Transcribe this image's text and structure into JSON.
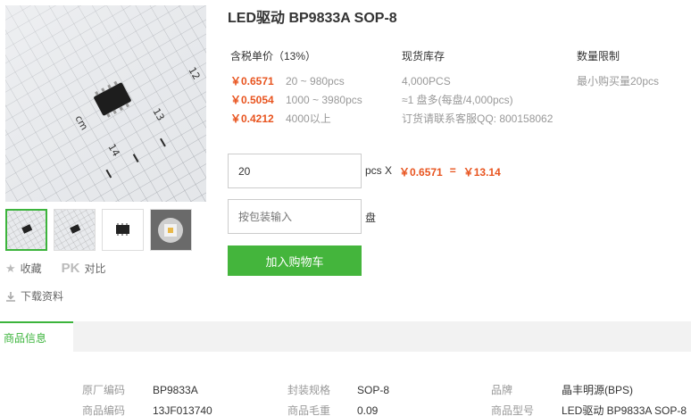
{
  "product": {
    "title": "LED驱动 BP9833A SOP-8"
  },
  "pricing": {
    "header": "含税单价（13%）",
    "tiers": [
      {
        "price": "￥0.6571",
        "range": "20 ~ 980pcs"
      },
      {
        "price": "￥0.5054",
        "range": "1000 ~ 3980pcs"
      },
      {
        "price": "￥0.4212",
        "range": "4000以上"
      }
    ]
  },
  "stock": {
    "header": "现货库存",
    "lines": [
      "4,000PCS",
      "≈1 盘多(每盘/4,000pcs)",
      "订货请联系客服QQ: 800158062"
    ]
  },
  "limit": {
    "header": "数量限制",
    "text": "最小购买量20pcs"
  },
  "order": {
    "qty_value": "20",
    "unit_x": "pcs X",
    "unit_price": "￥0.6571",
    "equals": "=",
    "total": "￥13.14",
    "pack_placeholder": "按包装输入",
    "pack_unit": "盘",
    "cart_label": "加入购物车"
  },
  "actions": {
    "favorite": "收藏",
    "pk": "PK",
    "compare": "对比",
    "download": "下载资料"
  },
  "tabs": {
    "active": "商品信息"
  },
  "specs": [
    {
      "key": "原厂编码",
      "value": "BP9833A"
    },
    {
      "key": "封装规格",
      "value": "SOP-8"
    },
    {
      "key": "品牌",
      "value": "晶丰明源(BPS)"
    },
    {
      "key": "商品编码",
      "value": "13JF013740"
    },
    {
      "key": "商品毛重",
      "value": "0.09"
    },
    {
      "key": "商品型号",
      "value": "LED驱动 BP9833A SOP-8"
    }
  ],
  "photo": {
    "ruler_numbers": [
      "12",
      "13",
      "14",
      "cm"
    ]
  },
  "colors": {
    "accent_green": "#44b53c",
    "price_orange": "#e8541f"
  }
}
